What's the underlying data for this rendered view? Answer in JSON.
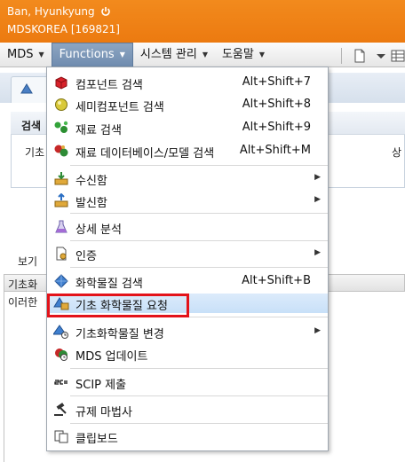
{
  "header": {
    "user_name": "Ban, Hyunkyung",
    "company": "MDSKOREA [169821]",
    "icons": {
      "power": "power-icon"
    }
  },
  "menubar": {
    "items": [
      {
        "label": "MDS"
      },
      {
        "label": "Functions"
      },
      {
        "label": "시스템 관리"
      },
      {
        "label": "도움말"
      }
    ],
    "toolbar_icons": [
      "new-document-icon",
      "dropdown-arrow-icon",
      "grid-icon"
    ]
  },
  "background": {
    "panel_title": "검색",
    "field_label_left": "기초",
    "field_label_right": "상",
    "view_label": "보기",
    "grid_header": "기초화",
    "grid_row_text": "이러한"
  },
  "functions_menu": {
    "items": [
      {
        "label": "컴포넌트 검색",
        "shortcut": "Alt+Shift+7",
        "icon": "red-cube-icon"
      },
      {
        "label": "세미컴포넌트 검색",
        "shortcut": "Alt+Shift+8",
        "icon": "yellow-sphere-icon"
      },
      {
        "label": "재료 검색",
        "shortcut": "Alt+Shift+9",
        "icon": "green-molecule-icon"
      },
      {
        "label": "재료 데이터베이스/모델 검색",
        "shortcut": "Alt+Shift+M",
        "icon": "database-molecule-icon"
      },
      {
        "label": "수신함",
        "icon": "inbox-icon"
      },
      {
        "label": "발신함",
        "icon": "outbox-icon"
      },
      {
        "label": "상세 분석",
        "icon": "flask-icon"
      },
      {
        "label": "인증",
        "icon": "certificate-icon"
      },
      {
        "label": "화학물질 검색",
        "shortcut": "Alt+Shift+B",
        "icon": "blue-diamond-icon"
      },
      {
        "label": "기초 화학물질 요청",
        "icon": "chemical-request-icon"
      },
      {
        "label": "기초화학물질 변경",
        "icon": "chemical-change-icon"
      },
      {
        "label": "MDS 업데이트",
        "icon": "mds-update-icon"
      },
      {
        "label": "SCIP 제출",
        "icon": "scip-icon"
      },
      {
        "label": "규제 마법사",
        "icon": "gavel-icon"
      },
      {
        "label": "클립보드",
        "icon": "clipboard-icon"
      }
    ]
  },
  "colors": {
    "header_orange": "#ef8418",
    "menu_active": "#7d98b8",
    "highlight_row": "#cfe3f9",
    "annotation_red": "#e3131a"
  }
}
